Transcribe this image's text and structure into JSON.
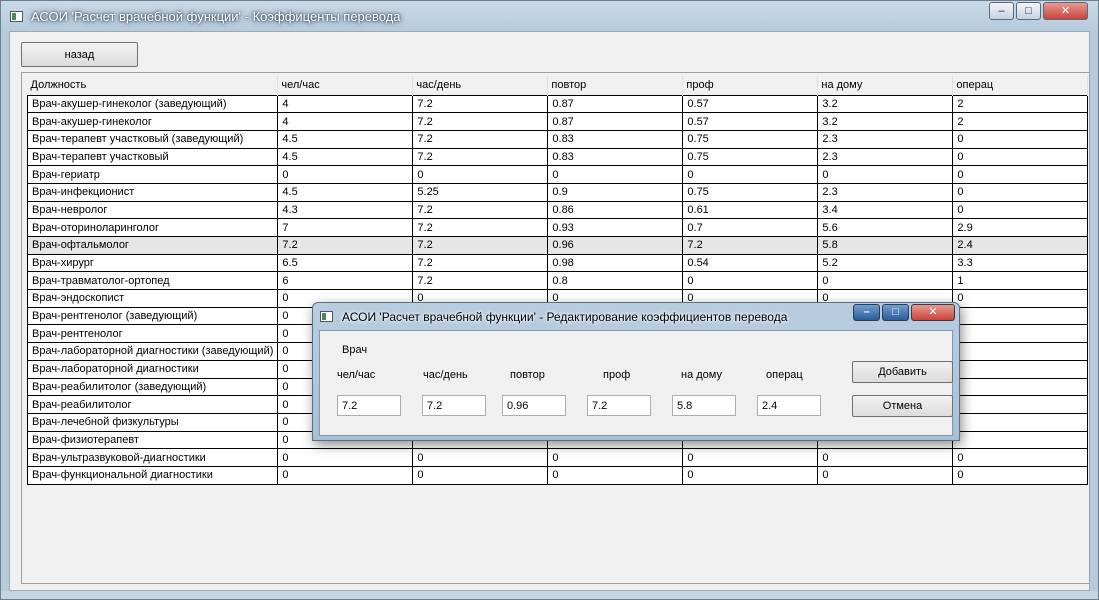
{
  "window": {
    "title": "АСОИ 'Расчет врачебной функции' - Коэффиценты перевода",
    "minimize": "–",
    "maximize": "□",
    "close": "✕"
  },
  "toolbar": {
    "back_label": "назад"
  },
  "grid": {
    "columns": [
      "Должность",
      "чел/час",
      "час/день",
      "повтор",
      "проф",
      "на дому",
      "операц"
    ],
    "rows": [
      [
        "Врач-акушер-гинеколог (заведующий)",
        "4",
        "7.2",
        "0.87",
        "0.57",
        "3.2",
        "2"
      ],
      [
        "Врач-акушер-гинеколог",
        "4",
        "7.2",
        "0.87",
        "0.57",
        "3.2",
        "2"
      ],
      [
        "Врач-терапевт участковый (заведующий)",
        "4.5",
        "7.2",
        "0.83",
        "0.75",
        "2.3",
        "0"
      ],
      [
        "Врач-терапевт участковый",
        "4.5",
        "7.2",
        "0.83",
        "0.75",
        "2.3",
        "0"
      ],
      [
        "Врач-гериатр",
        "0",
        "0",
        "0",
        "0",
        "0",
        "0"
      ],
      [
        "Врач-инфекционист",
        "4.5",
        "5.25",
        "0.9",
        "0.75",
        "2.3",
        "0"
      ],
      [
        "Врач-невролог",
        "4.3",
        "7.2",
        "0.86",
        "0.61",
        "3.4",
        "0"
      ],
      [
        "Врач-оториноларинголог",
        "7",
        "7.2",
        "0.93",
        "0.7",
        "5.6",
        "2.9"
      ],
      [
        "Врач-офтальмолог",
        "7.2",
        "7.2",
        "0.96",
        "7.2",
        "5.8",
        "2.4"
      ],
      [
        "Врач-хирург",
        "6.5",
        "7.2",
        "0.98",
        "0.54",
        "5.2",
        "3.3"
      ],
      [
        "Врач-травматолог-ортопед",
        "6",
        "7.2",
        "0.8",
        "0",
        "0",
        "1"
      ],
      [
        "Врач-эндоскопист",
        "0",
        "0",
        "0",
        "0",
        "0",
        "0"
      ],
      [
        "Врач-рентгенолог (заведующий)",
        "0",
        "",
        "",
        "",
        "",
        ""
      ],
      [
        "Врач-рентгенолог",
        "0",
        "",
        "",
        "",
        "",
        ""
      ],
      [
        "Врач-лабораторной диагностики  (заведующий)",
        "0",
        "",
        "",
        "",
        "",
        ""
      ],
      [
        "Врач-лабораторной диагностики",
        "0",
        "",
        "",
        "",
        "",
        ""
      ],
      [
        "Врач-реабилитолог (заведующий)",
        "0",
        "",
        "",
        "",
        "",
        ""
      ],
      [
        "Врач-реабилитолог",
        "0",
        "",
        "",
        "",
        "",
        ""
      ],
      [
        "Врач-лечебной физкультуры",
        "0",
        "",
        "",
        "",
        "",
        ""
      ],
      [
        "Врач-физиотерапевт",
        "0",
        "",
        "",
        "",
        "",
        ""
      ],
      [
        "Врач-ультразвуковой-диагностики",
        "0",
        "0",
        "0",
        "0",
        "0",
        "0"
      ],
      [
        "Врач-функциональной диагностики",
        "0",
        "0",
        "0",
        "0",
        "0",
        "0"
      ]
    ]
  },
  "dialog": {
    "title": "АСОИ 'Расчет врачебной функции' - Редактирование коэффициентов перевода",
    "doctor_label": "Врач",
    "field_labels": [
      "чел/час",
      "час/день",
      "повтор",
      "проф",
      "на дому",
      "операц"
    ],
    "field_values": [
      "7.2",
      "7.2",
      "0.96",
      "7.2",
      "5.8",
      "2.4"
    ],
    "add_label": "Добавить",
    "cancel_label": "Отмена",
    "minimize": "–",
    "maximize": "□",
    "close": "✕"
  },
  "colors": {
    "titlebar": "#b7cbdd",
    "close_button": "#c8453a",
    "dialog_button_blue": "#2d5b93"
  }
}
